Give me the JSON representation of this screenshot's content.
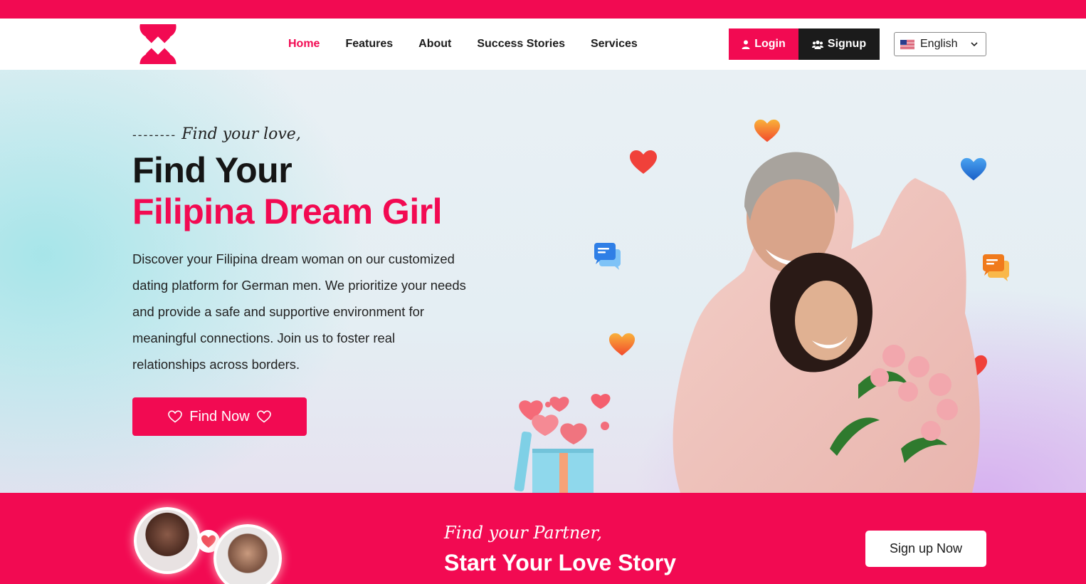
{
  "colors": {
    "brand": "#f20a52",
    "dark": "#1b1b1b",
    "white": "#ffffff"
  },
  "header": {
    "logo_icon": "double-heart-logo",
    "nav": [
      {
        "label": "Home",
        "active": true
      },
      {
        "label": "Features",
        "active": false
      },
      {
        "label": "About",
        "active": false
      },
      {
        "label": "Success Stories",
        "active": false
      },
      {
        "label": "Services",
        "active": false
      }
    ],
    "login_label": "Login",
    "login_icon": "user-icon",
    "signup_label": "Signup",
    "signup_icon": "users-icon",
    "language": {
      "selected": "English",
      "flag_icon": "us-flag-icon"
    }
  },
  "hero": {
    "tagline_dashes": "--------",
    "tagline": "Find your love,",
    "title_line1": "Find Your",
    "title_line2": "Filipina Dream Girl",
    "description": "Discover your Filipina dream woman on our customized dating platform for German men. We prioritize your needs and provide a safe and supportive environment for meaningful connections. Join us to foster real relationships across borders.",
    "cta_label": "Find Now",
    "cta_icon": "heart-outline-icon",
    "image": "couple-photo",
    "decorations": [
      "heart-icon",
      "chat-bubble-icon",
      "gift-box-icon"
    ]
  },
  "cta_banner": {
    "script": "Find your Partner,",
    "title": "Start Your Love Story",
    "button_label": "Sign up Now"
  }
}
